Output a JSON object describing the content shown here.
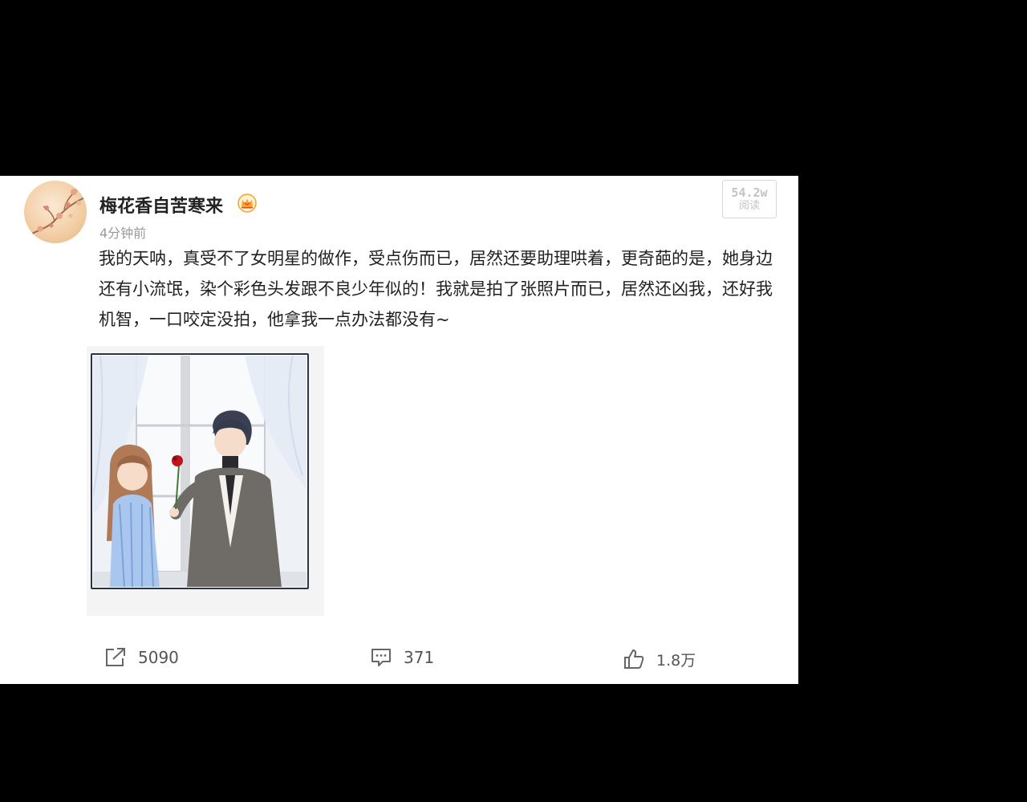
{
  "post": {
    "username": "梅花香自苦寒来",
    "timestamp": "4分钟前",
    "read_count": "54.2w",
    "read_label": "阅读",
    "content": "我的天呐，真受不了女明星的做作，受点伤而已，居然还要助理哄着，更奇葩的是，她身边还有小流氓，染个彩色头发跟不良少年似的！我就是拍了张照片而已，居然还凶我，还好我机智，一口咬定没拍，他拿我一点办法都没有~",
    "badge_icon": "crown-icon",
    "image_icon": "illustration-couple-with-rose"
  },
  "actions": {
    "share": {
      "icon": "share-icon",
      "count": "5090"
    },
    "comment": {
      "icon": "comment-icon",
      "count": "371"
    },
    "like": {
      "icon": "thumbs-up-icon",
      "count": "1.8万"
    }
  },
  "colors": {
    "background": "#000000",
    "card": "#ffffff",
    "text": "#222222",
    "muted": "#999999",
    "crown": "#f5a623"
  }
}
